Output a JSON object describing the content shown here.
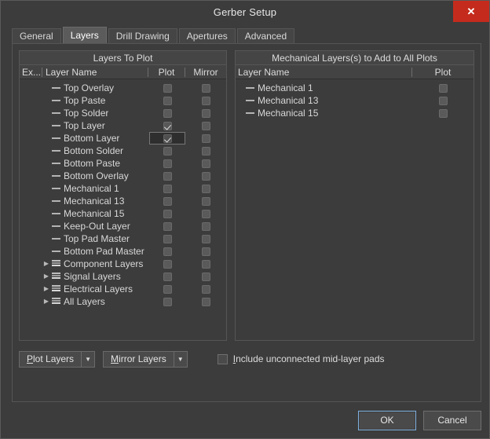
{
  "window": {
    "title": "Gerber Setup",
    "close_label": "✕"
  },
  "tabs": [
    {
      "label": "General",
      "active": false
    },
    {
      "label": "Layers",
      "active": true
    },
    {
      "label": "Drill Drawing",
      "active": false
    },
    {
      "label": "Apertures",
      "active": false
    },
    {
      "label": "Advanced",
      "active": false
    }
  ],
  "left_panel": {
    "caption": "Layers To Plot",
    "columns": {
      "extend": "Ex...",
      "layer_name": "Layer Name",
      "plot": "Plot",
      "mirror": "Mirror"
    },
    "rows": [
      {
        "name": "Top Overlay",
        "icon": "single-layer-icon",
        "group": false,
        "plot": false,
        "mirror": false,
        "plot_focused": false
      },
      {
        "name": "Top Paste",
        "icon": "single-layer-icon",
        "group": false,
        "plot": false,
        "mirror": false,
        "plot_focused": false
      },
      {
        "name": "Top Solder",
        "icon": "single-layer-icon",
        "group": false,
        "plot": false,
        "mirror": false,
        "plot_focused": false
      },
      {
        "name": "Top Layer",
        "icon": "single-layer-icon",
        "group": false,
        "plot": true,
        "mirror": false,
        "plot_focused": false
      },
      {
        "name": "Bottom Layer",
        "icon": "single-layer-icon",
        "group": false,
        "plot": true,
        "mirror": false,
        "plot_focused": true
      },
      {
        "name": "Bottom Solder",
        "icon": "single-layer-icon",
        "group": false,
        "plot": false,
        "mirror": false,
        "plot_focused": false
      },
      {
        "name": "Bottom Paste",
        "icon": "single-layer-icon",
        "group": false,
        "plot": false,
        "mirror": false,
        "plot_focused": false
      },
      {
        "name": "Bottom Overlay",
        "icon": "single-layer-icon",
        "group": false,
        "plot": false,
        "mirror": false,
        "plot_focused": false
      },
      {
        "name": "Mechanical 1",
        "icon": "single-layer-icon",
        "group": false,
        "plot": false,
        "mirror": false,
        "plot_focused": false
      },
      {
        "name": "Mechanical 13",
        "icon": "single-layer-icon",
        "group": false,
        "plot": false,
        "mirror": false,
        "plot_focused": false
      },
      {
        "name": "Mechanical 15",
        "icon": "single-layer-icon",
        "group": false,
        "plot": false,
        "mirror": false,
        "plot_focused": false
      },
      {
        "name": "Keep-Out Layer",
        "icon": "single-layer-icon",
        "group": false,
        "plot": false,
        "mirror": false,
        "plot_focused": false
      },
      {
        "name": "Top Pad Master",
        "icon": "single-layer-icon",
        "group": false,
        "plot": false,
        "mirror": false,
        "plot_focused": false
      },
      {
        "name": "Bottom Pad Master",
        "icon": "single-layer-icon",
        "group": false,
        "plot": false,
        "mirror": false,
        "plot_focused": false
      },
      {
        "name": "Component Layers",
        "icon": "stacked-layers-icon",
        "group": true,
        "plot": false,
        "mirror": false,
        "plot_focused": false
      },
      {
        "name": "Signal Layers",
        "icon": "stacked-layers-icon",
        "group": true,
        "plot": false,
        "mirror": false,
        "plot_focused": false
      },
      {
        "name": "Electrical Layers",
        "icon": "stacked-layers-icon",
        "group": true,
        "plot": false,
        "mirror": false,
        "plot_focused": false
      },
      {
        "name": "All Layers",
        "icon": "stacked-layers-icon",
        "group": true,
        "plot": false,
        "mirror": false,
        "plot_focused": false
      }
    ]
  },
  "right_panel": {
    "caption": "Mechanical Layers(s) to Add to All Plots",
    "columns": {
      "layer_name": "Layer Name",
      "plot": "Plot"
    },
    "rows": [
      {
        "name": "Mechanical 1",
        "icon": "single-layer-icon",
        "plot": false
      },
      {
        "name": "Mechanical 13",
        "icon": "single-layer-icon",
        "plot": false
      },
      {
        "name": "Mechanical 15",
        "icon": "single-layer-icon",
        "plot": false
      }
    ]
  },
  "controls": {
    "plot_layers": {
      "accel": "P",
      "rest": "lot Layers"
    },
    "mirror_layers": {
      "accel": "M",
      "rest": "irror Layers"
    },
    "include_mid_layer_pads": {
      "accel": "I",
      "rest": "nclude unconnected mid-layer pads",
      "checked": false
    },
    "dropdown_arrow": "▼",
    "expander_arrow": "▶"
  },
  "footer": {
    "ok": "OK",
    "cancel": "Cancel"
  },
  "colors": {
    "window_bg": "#3c3c3c",
    "close_red": "#c42b1c",
    "focus_blue": "#7fb0e0",
    "text": "#d8d8d8"
  }
}
